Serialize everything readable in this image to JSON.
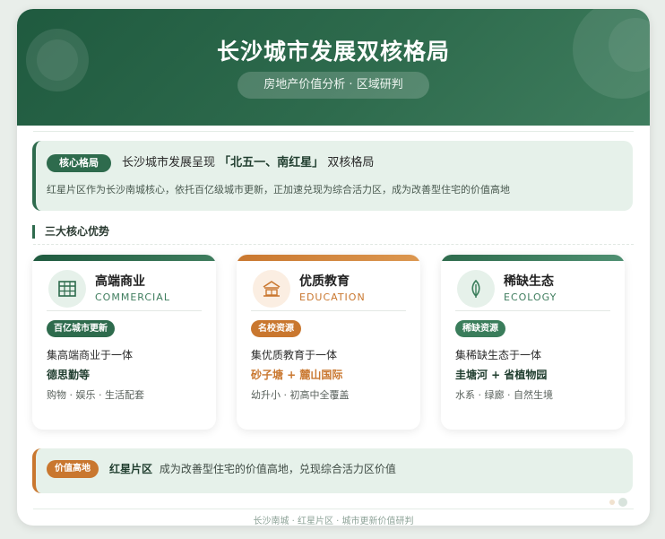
{
  "header": {
    "title": "长沙城市发展双核格局",
    "subtitle": "房地产价值分析 · 区域研判"
  },
  "core": {
    "tag": "核心格局",
    "text_prefix": "长沙城市发展呈现",
    "text_highlight": "「北五一、南红星」",
    "text_suffix": "双核格局",
    "description": "红星片区作为长沙南城核心，依托百亿级城市更新，正加速兑现为综合活力区，成为改善型住宅的价值高地"
  },
  "section": {
    "title": "三大核心优势"
  },
  "features": [
    {
      "name": "高端商业",
      "en": "COMMERCIAL",
      "icon": "building-icon",
      "tag": "百亿城市更新",
      "line1": "集高端商业于一体",
      "line2": "德思勤等",
      "line3": "购物 · 娱乐 · 生活配套",
      "color": "#2e6b4d"
    },
    {
      "name": "优质教育",
      "en": "EDUCATION",
      "icon": "school-icon",
      "tag": "名校资源",
      "line1": "集优质教育于一体",
      "line2": "砂子塘 + 麓山国际",
      "line3": "幼升小 · 初高中全覆盖",
      "color": "#c9772f"
    },
    {
      "name": "稀缺生态",
      "en": "ECOLOGY",
      "icon": "leaf-icon",
      "tag": "稀缺资源",
      "line1": "集稀缺生态于一体",
      "line2": "圭塘河 + 省植物园",
      "line3": "水系 · 绿廊 · 自然生境",
      "color": "#3a7d5b"
    }
  ],
  "value": {
    "tag": "价值高地",
    "highlight": "红星片区",
    "text": "成为改善型住宅的价值高地，兑现综合活力区价值"
  },
  "footer": {
    "text": "长沙南城 · 红星片区 · 城市更新价值研判"
  },
  "colors": {
    "primary": "#2e6b4d",
    "accent": "#c9772f",
    "light_bg": "#e6f1ea"
  }
}
